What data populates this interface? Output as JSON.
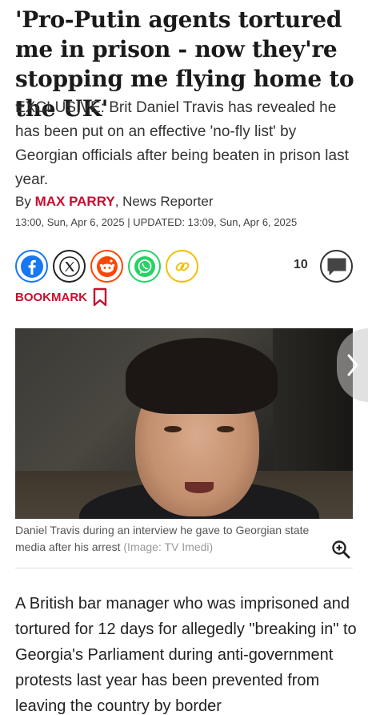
{
  "article": {
    "headline": "'Pro-Putin agents tortured me in prison - now they're stopping me flying home to the UK'",
    "standfirst": "EXCLUSIVE: Brit Daniel Travis has revealed he has been put on an effective 'no-fly list' by Georgian officials after being beaten in prison last year.",
    "byline_prefix": "By ",
    "author": "MAX PARRY",
    "author_role": ", News Reporter",
    "timestamp": "13:00, Sun, Apr 6, 2025 | UPDATED: 13:09, Sun, Apr 6, 2025",
    "body": "A British bar manager who was imprisoned and tortured for 12 days for allegedly \"breaking in\" to Georgia's Parliament during anti-government protests last year has been prevented from leaving the country by border"
  },
  "share": {
    "buttons": [
      {
        "icon": "facebook-icon",
        "color": "#1877f2"
      },
      {
        "icon": "x-icon",
        "color": "#222222"
      },
      {
        "icon": "reddit-icon",
        "color": "#ff4500"
      },
      {
        "icon": "whatsapp-icon",
        "color": "#25d366"
      },
      {
        "icon": "link-icon",
        "color": "#f2c000"
      }
    ],
    "comment_count": "10",
    "bookmark_label": "BOOKMARK"
  },
  "image": {
    "caption": "Daniel Travis during an interview he gave to Georgian state media after his arrest",
    "credit": "(Image: TV Imedi)"
  },
  "colors": {
    "accent": "#c8102e"
  }
}
